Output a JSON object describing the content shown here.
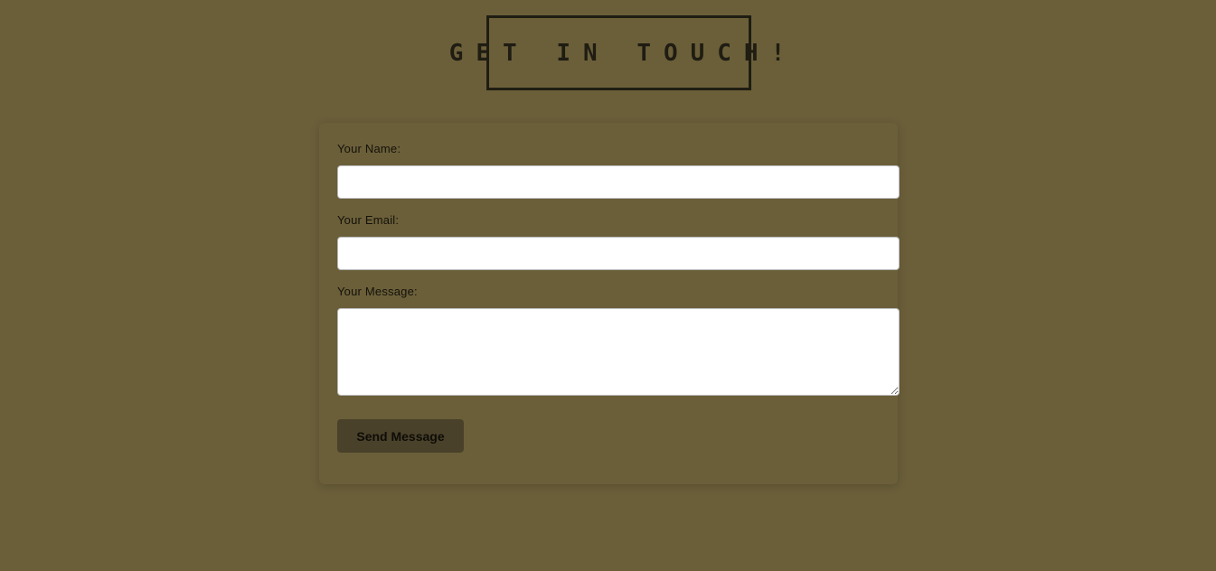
{
  "header": {
    "title": "GET IN TOUCH!"
  },
  "form": {
    "name_label": "Your Name:",
    "name_value": "",
    "email_label": "Your Email:",
    "email_value": "",
    "message_label": "Your Message:",
    "message_value": "",
    "submit_label": "Send Message"
  },
  "colors": {
    "background": "#6b5f3a",
    "title_border": "#1f1d12",
    "button_background": "#4a412a"
  }
}
